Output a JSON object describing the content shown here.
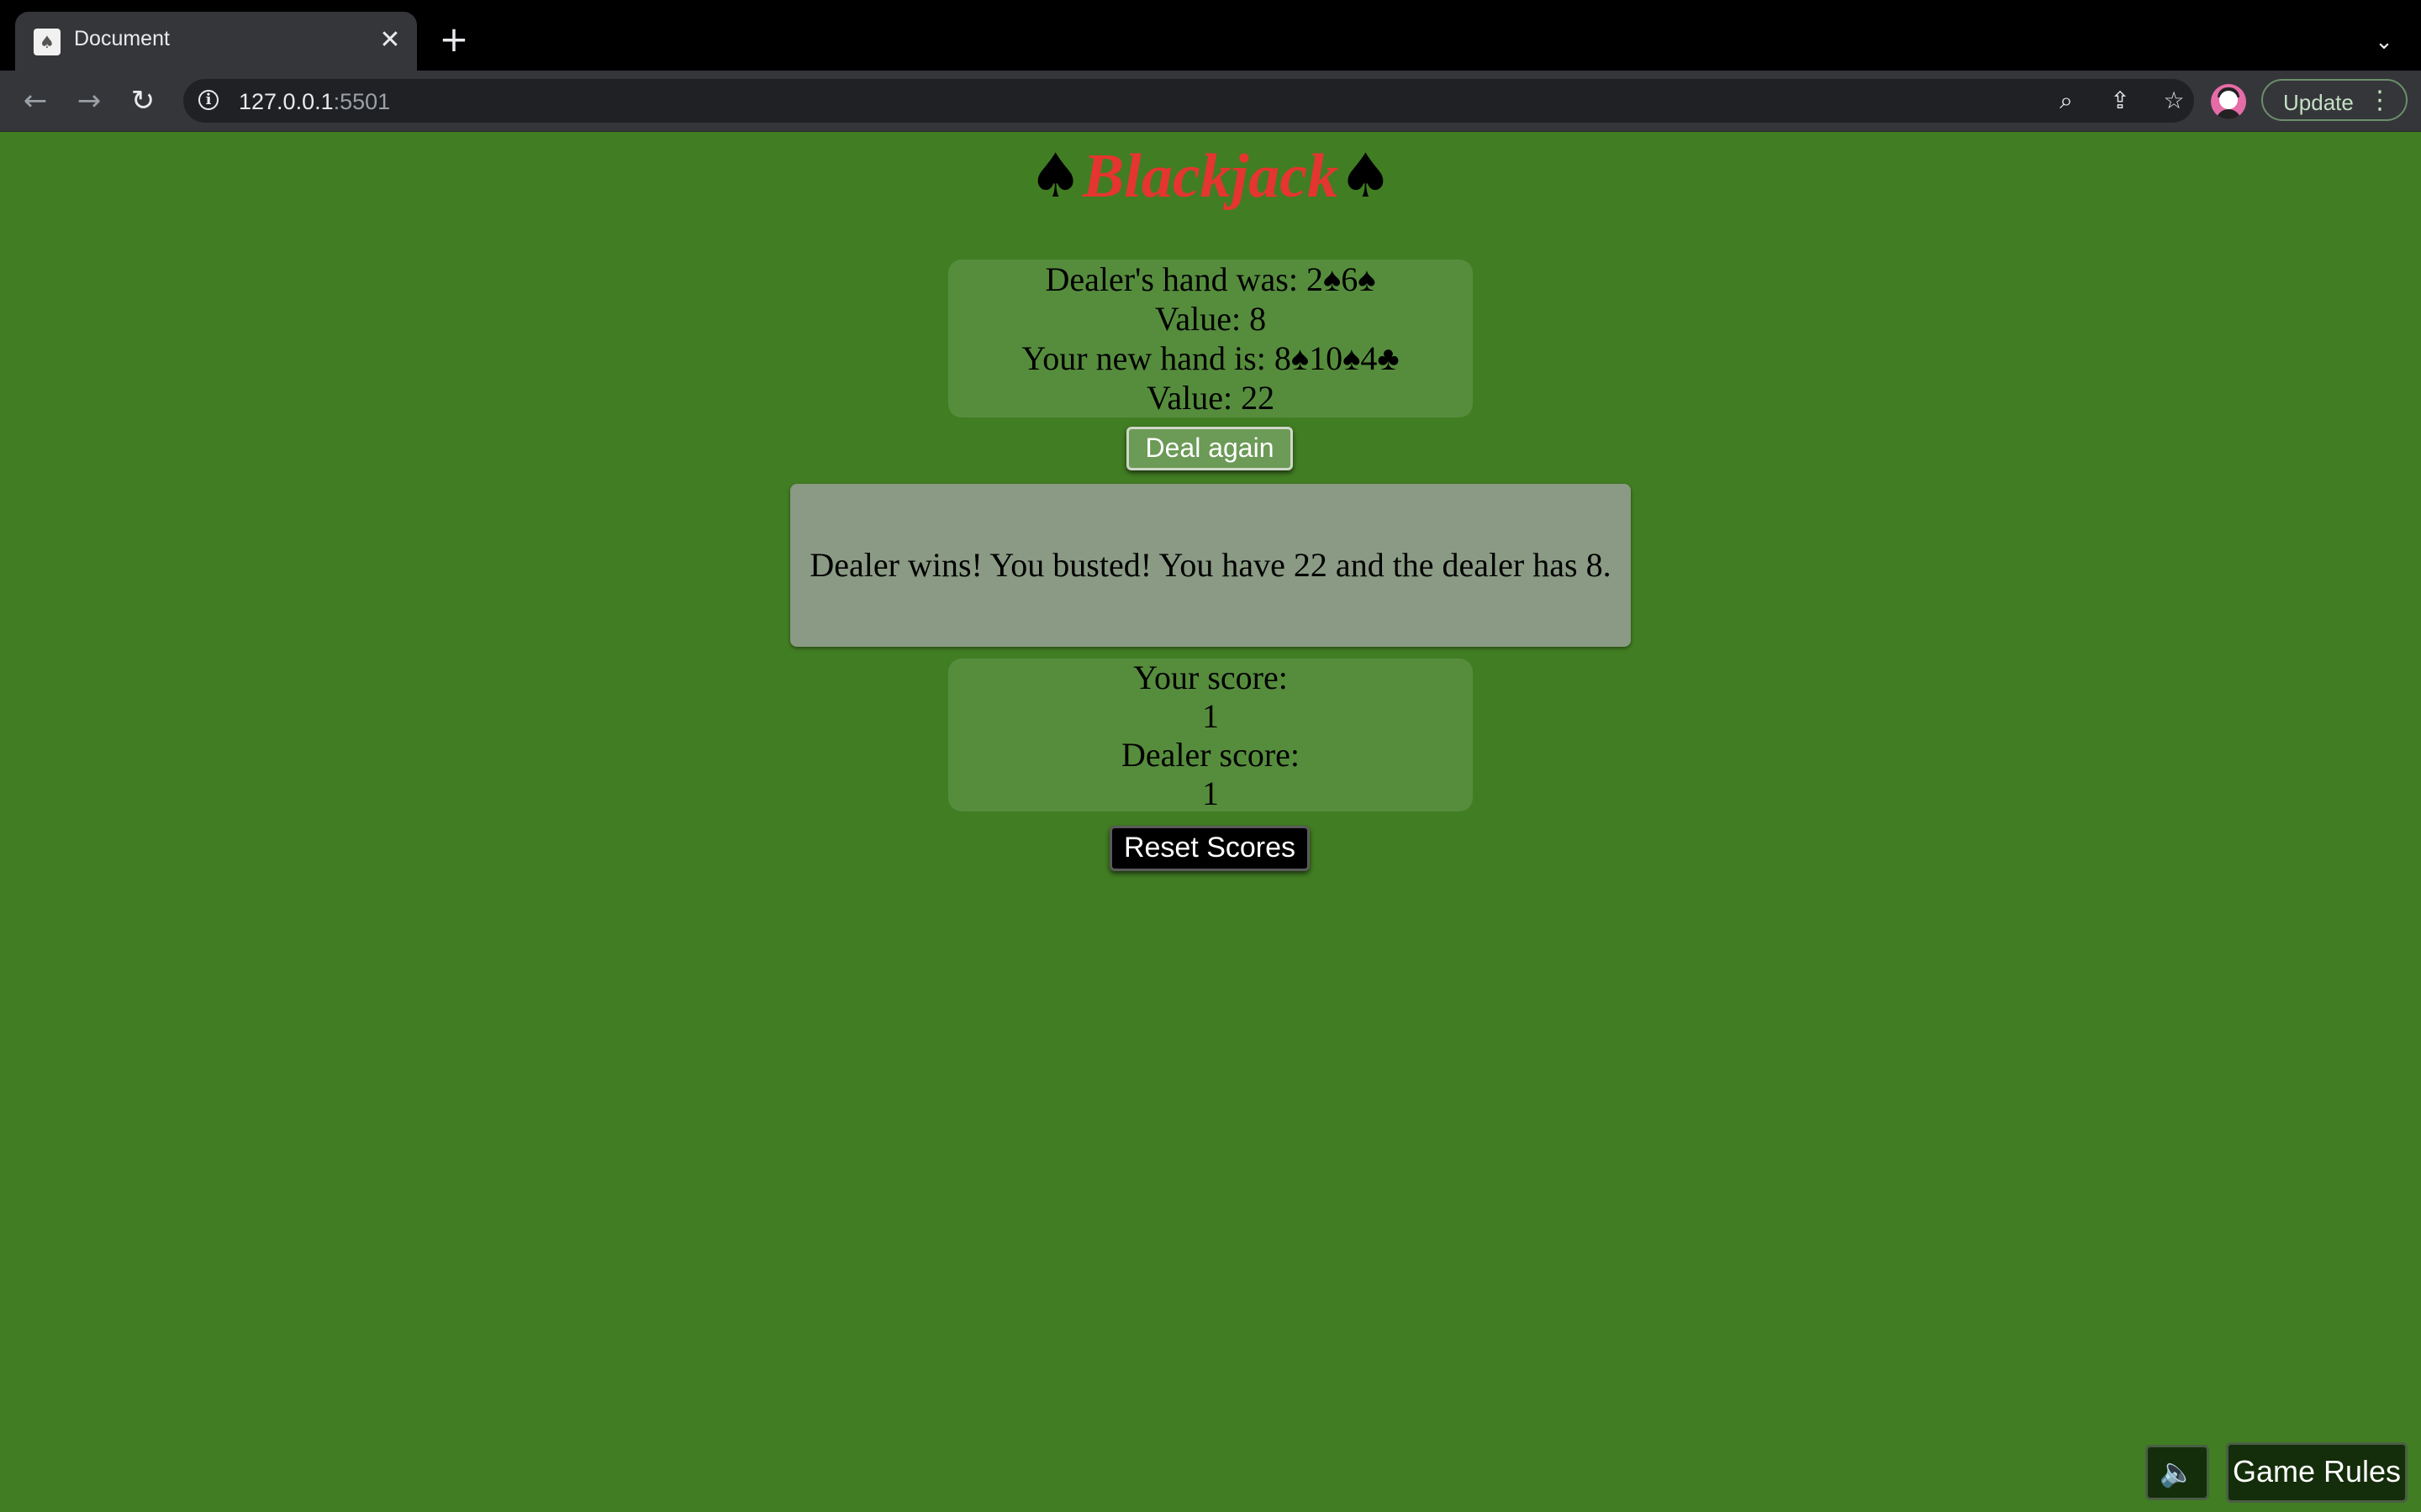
{
  "browser": {
    "tab_title": "Document",
    "tab_close": "✕",
    "new_tab": "+",
    "tab_list": "⌄",
    "url_host": "127.0.0.1",
    "url_port": ":5501",
    "back": "←",
    "forward": "→",
    "reload": "↻",
    "info": "i",
    "zoom_icon": "⌕",
    "share_icon": "⇪",
    "bookmark_icon": "☆",
    "update_label": "Update",
    "menu_dots": "⋮"
  },
  "game": {
    "title_left_spade": "♠",
    "title_word": "Blackjack",
    "title_right_spade": "♠",
    "dealer_hand": "Dealer's hand was: 2♠6♠",
    "dealer_value": "Value: 8",
    "player_hand": "Your new hand is: 8♠10♠4♣",
    "player_value": "Value: 22",
    "deal_again_label": "Deal again",
    "result_message": "Dealer wins! You busted! You have 22 and the dealer has 8.",
    "your_score_label": "Your score:",
    "your_score": "1",
    "dealer_score_label": "Dealer score:",
    "dealer_score": "1",
    "reset_label": "Reset Scores",
    "sound_icon": "🔈",
    "rules_label": "Game Rules"
  },
  "colors": {
    "table_green": "#417d22",
    "panel_green": "#568d3d",
    "title_red": "#e53530",
    "result_gray": "#8a9a84"
  }
}
